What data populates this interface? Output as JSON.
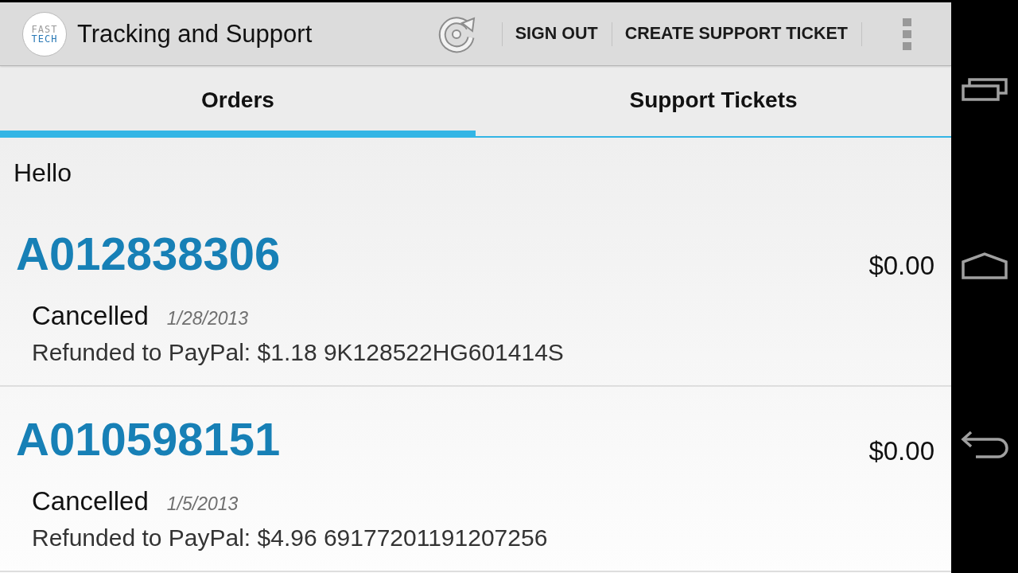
{
  "action_bar": {
    "logo": {
      "line_1": "FAST",
      "line_2": "TECH"
    },
    "title": "Tracking and Support",
    "actions": [
      "SIGN OUT",
      "CREATE SUPPORT TICKET"
    ]
  },
  "tabs": [
    {
      "label": "Orders",
      "selected": true
    },
    {
      "label": "Support Tickets",
      "selected": false
    }
  ],
  "greeting": "Hello",
  "orders": [
    {
      "number": "A012838306",
      "total": "$0.00",
      "status": "Cancelled",
      "date": "1/28/2013",
      "refund": "Refunded to PayPal: $1.18 9K128522HG601414S"
    },
    {
      "number": "A010598151",
      "total": "$0.00",
      "status": "Cancelled",
      "date": "1/5/2013",
      "refund": "Refunded to PayPal: $4.96 69177201191207256"
    }
  ]
}
